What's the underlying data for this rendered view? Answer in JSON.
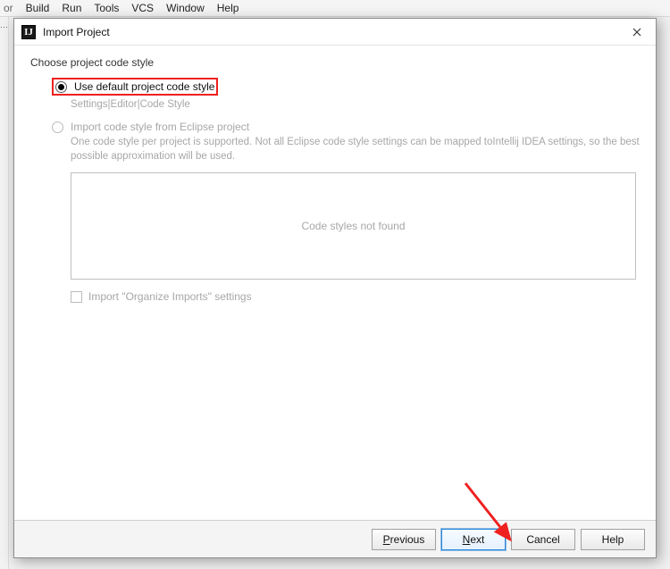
{
  "menubar": {
    "items": [
      "Build",
      "Run",
      "Tools",
      "VCS",
      "Window",
      "Help"
    ],
    "prefix": "or"
  },
  "sidebar": {
    "decor": "…"
  },
  "dialog": {
    "title": "Import Project",
    "icon_glyph": "IJ",
    "heading": "Choose project code style",
    "option1": {
      "label": "Use default project code style",
      "hint": "Settings|Editor|Code Style",
      "selected": true
    },
    "option2": {
      "label": "Import code style from Eclipse project",
      "hint": "One code style per project is supported. Not all Eclipse code style settings can be mapped toIntellij IDEA settings, so the best possible approximation will be used.",
      "selected": false
    },
    "listbox_placeholder": "Code styles not found",
    "checkbox": {
      "label": "Import \"Organize Imports\" settings",
      "checked": false
    },
    "buttons": {
      "previous": "Previous",
      "next": "Next",
      "cancel": "Cancel",
      "help": "Help"
    }
  }
}
